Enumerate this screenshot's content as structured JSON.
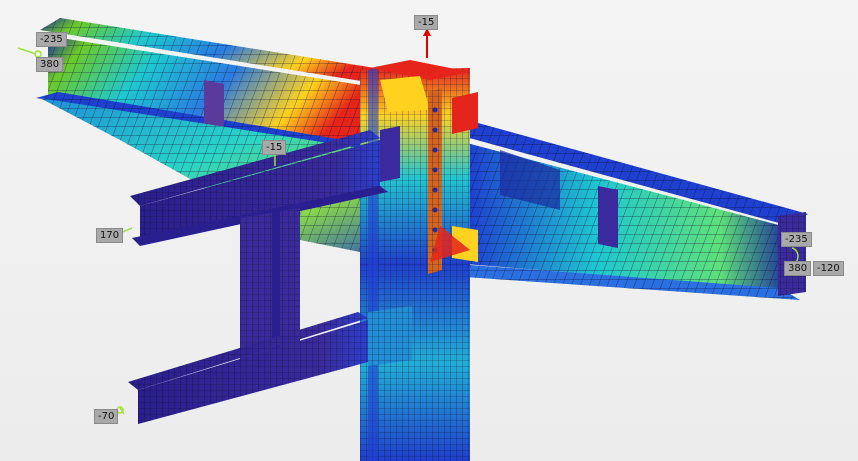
{
  "loads": {
    "top_vertical": "-15",
    "left_beam_top": "-235",
    "left_beam_bottom": "380",
    "upper_secondary": "-15",
    "upper_secondary_end": "170",
    "lower_secondary_end": "-70",
    "right_beam_top": "-235",
    "right_beam_bottom": "380",
    "right_beam_side": "-120"
  },
  "colors": {
    "background": "#f0f0f0",
    "load_label_bg": "#a9a9a9",
    "load_arrow": "#e00000",
    "moment_marker": "#9be23a",
    "stress_low": "#1a1a9a",
    "stress_mid": "#1fd6d6",
    "stress_high": "#e21a1a"
  },
  "icons": [
    "vertical-force-arrow-icon",
    "moment-marker-icon"
  ]
}
